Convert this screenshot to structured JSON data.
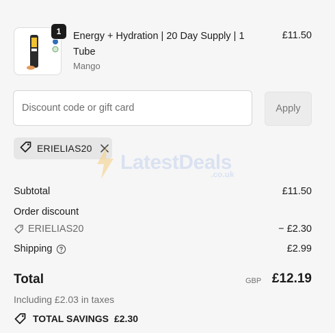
{
  "product": {
    "quantity": "1",
    "title": "Energy + Hydration | 20 Day Supply | 1 Tube",
    "variant": "Mango",
    "price": "£11.50",
    "thumbnail_icon": "tube-product-image"
  },
  "discount": {
    "placeholder": "Discount code or gift card",
    "value": "",
    "apply_label": "Apply"
  },
  "applied_code": {
    "code": "ERIELIAS20",
    "icon": "tag-icon",
    "remove_icon": "close-icon"
  },
  "watermark": {
    "text": "LatestDeals",
    "sub": ".co.uk"
  },
  "summary": {
    "subtotal_label": "Subtotal",
    "subtotal_value": "£11.50",
    "order_discount_label": "Order discount",
    "discount_code": "ERIELIAS20",
    "discount_value": "− £2.30",
    "shipping_label": "Shipping",
    "shipping_value": "£2.99"
  },
  "total": {
    "label": "Total",
    "currency": "GBP",
    "amount": "£12.19",
    "taxes": "Including £2.03 in taxes",
    "savings_label": "TOTAL SAVINGS",
    "savings_value": "£2.30"
  },
  "colors": {
    "background": "#f6f6f6",
    "text": "#1b1b1b",
    "muted": "#707070",
    "chip": "#e6e6e6"
  }
}
